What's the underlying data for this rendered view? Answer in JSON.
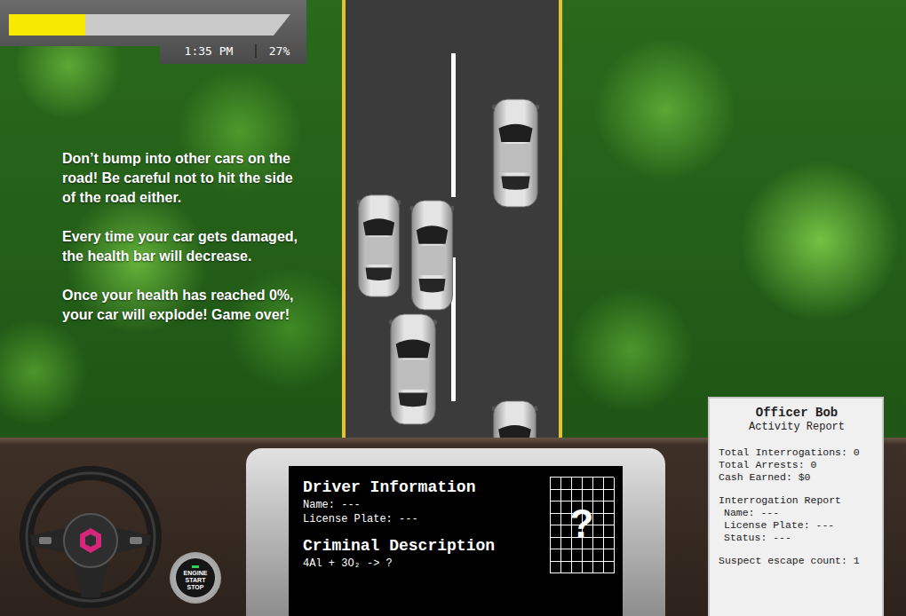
{
  "hud": {
    "health": {
      "level": 0.27
    },
    "time": "1:35 PM",
    "percent": "27%"
  },
  "instructions": [
    "Don’t bump into other cars on the road! Be careful not to hit the side of the road either.",
    "Every time your car gets damaged, the health bar will decrease.",
    "Once your health has reached 0%, your car will explode! Game over!"
  ],
  "dashboard": {
    "engine_button": {
      "lines": [
        "ENGINE",
        "START",
        "STOP"
      ]
    },
    "display": {
      "driver_title": "Driver Information",
      "driver_fields": [
        "Name: ---",
        "License Plate: ---"
      ],
      "criminal_title": "Criminal Description",
      "criminal_description": "4Al + 3O₂ -> ?",
      "portrait": "?"
    }
  },
  "report": {
    "title": "Officer Bob",
    "subtitle": "Activity Report",
    "totals": [
      "Total Interrogations: 0",
      "Total Arrests: 0",
      "Cash Earned: $0"
    ],
    "interrogation_title": "Interrogation Report",
    "interrogation_fields": [
      "Name: ---",
      "License Plate: ---",
      "Status: ---"
    ],
    "escape": "Suspect escape count: 1"
  }
}
